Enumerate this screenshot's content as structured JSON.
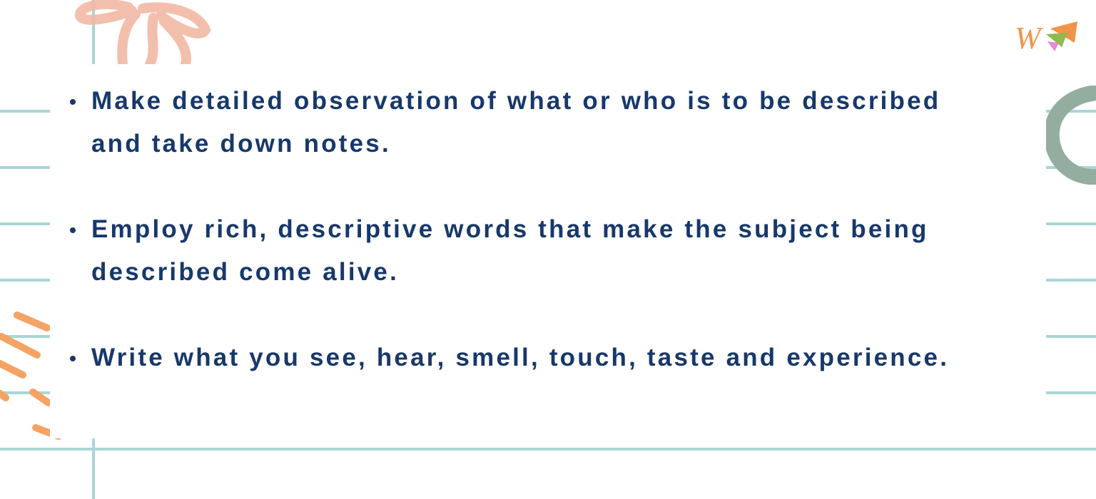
{
  "slide": {
    "bullets": [
      {
        "text": "Make detailed observation of what or who is to be described and take down notes."
      },
      {
        "text": "Employ rich, descriptive words that make the subject being described come alive."
      },
      {
        "text": "Write what you see, hear, smell, touch, taste and experience."
      }
    ]
  },
  "logo": {
    "letter": "W"
  },
  "colors": {
    "text": "#17386b",
    "line": "#a9d6d5",
    "flower": "#f2b9a5",
    "swirl": "#93ada0",
    "strokes": "#f5a363"
  }
}
